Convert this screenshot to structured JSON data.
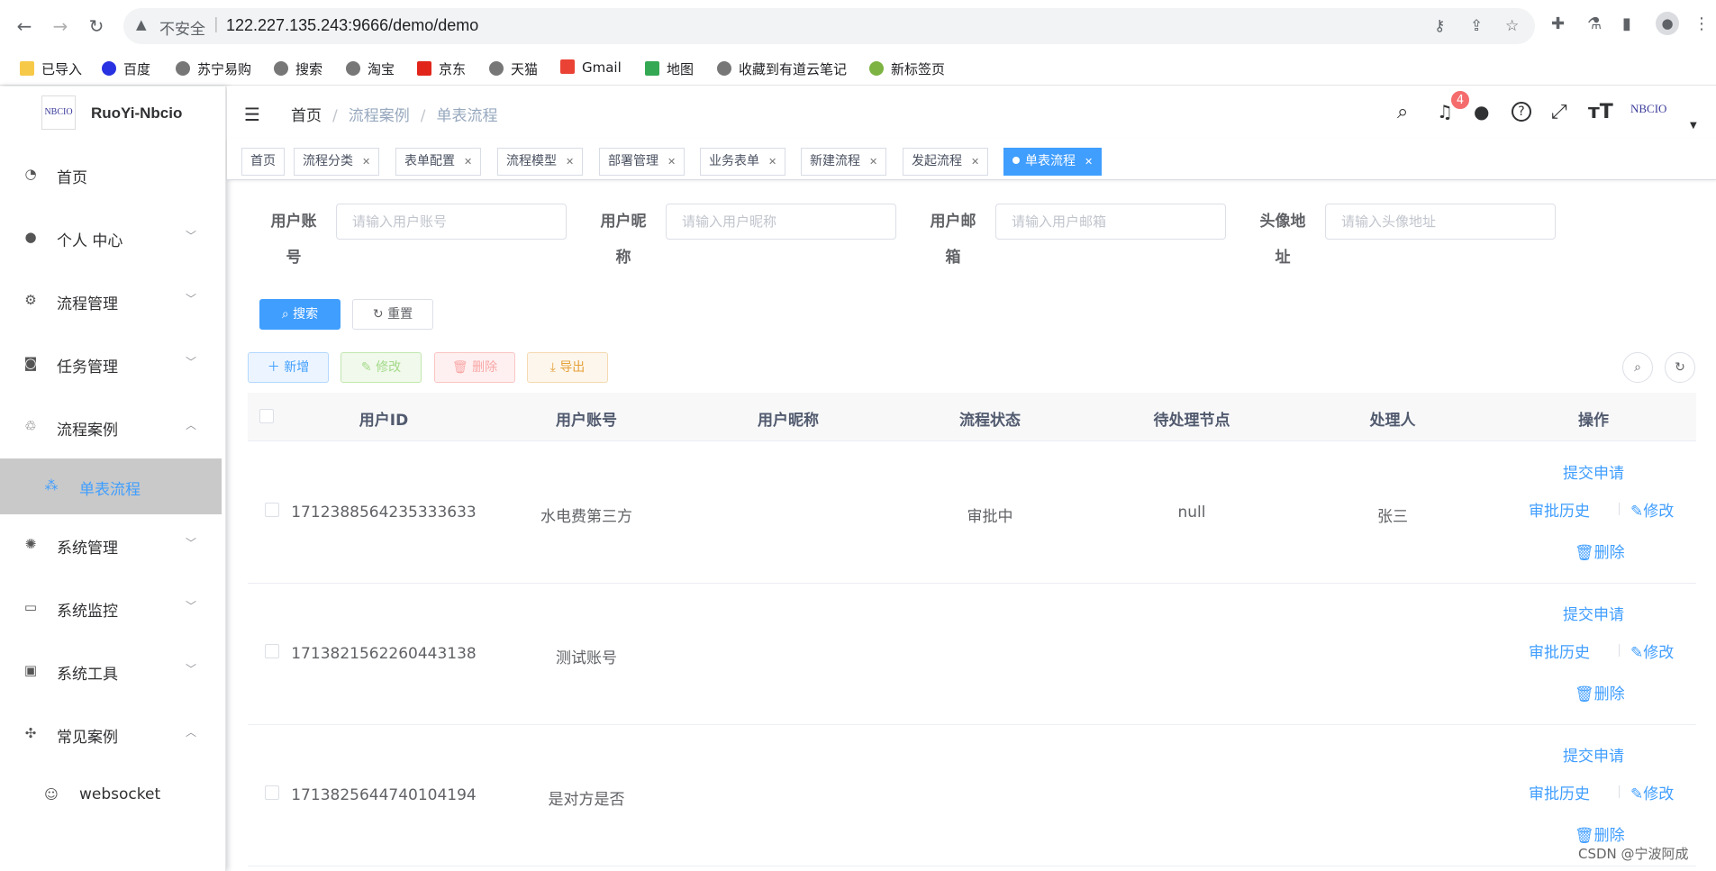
{
  "browser": {
    "insecure_label": "不安全",
    "url": "122.227.135.243:9666/demo/demo",
    "bookmarks": [
      "已导入",
      "百度",
      "苏宁易购",
      "搜索",
      "淘宝",
      "京东",
      "天猫",
      "Gmail",
      "地图",
      "收藏到有道云笔记",
      "新标签页"
    ]
  },
  "sidebar": {
    "logo_text": "NBCIO",
    "title": "RuoYi-Nbcio",
    "items": [
      {
        "label": "首页",
        "icon": "dashboard-icon"
      },
      {
        "label": "个人 中心",
        "icon": "user-icon",
        "arrow": "﹀"
      },
      {
        "label": "流程管理",
        "icon": "flow-icon",
        "arrow": "﹀"
      },
      {
        "label": "任务管理",
        "icon": "task-icon",
        "arrow": "﹀"
      },
      {
        "label": "流程案例",
        "icon": "case-icon",
        "arrow": "︿"
      },
      {
        "label": "单表流程",
        "icon": "tree-icon"
      },
      {
        "label": "系统管理",
        "icon": "system-icon",
        "arrow": "﹀"
      },
      {
        "label": "系统监控",
        "icon": "monitor-icon",
        "arrow": "﹀"
      },
      {
        "label": "系统工具",
        "icon": "tool-icon",
        "arrow": "﹀"
      },
      {
        "label": "常见案例",
        "icon": "example-icon",
        "arrow": "︿"
      },
      {
        "label": "websocket",
        "icon": "robot-icon"
      }
    ]
  },
  "header": {
    "breadcrumb": [
      "首页",
      "流程案例",
      "单表流程"
    ],
    "notification_count": "4",
    "avatar_text": "NBCIO"
  },
  "tags": [
    "首页",
    "流程分类",
    "表单配置",
    "流程模型",
    "部署管理",
    "业务表单",
    "新建流程",
    "发起流程",
    "单表流程"
  ],
  "search": {
    "fields": [
      {
        "label": "用户账号",
        "placeholder": "请输入用户账号",
        "value": ""
      },
      {
        "label": "用户昵称",
        "placeholder": "请输入用户昵称",
        "value": ""
      },
      {
        "label": "用户邮箱",
        "placeholder": "请输入用户邮箱",
        "value": ""
      },
      {
        "label": "头像地址",
        "placeholder": "请输入头像地址",
        "value": ""
      }
    ],
    "search_button": "搜索",
    "reset_button": "重置"
  },
  "toolbar": {
    "add": "新增",
    "edit": "修改",
    "delete": "删除",
    "export": "导出"
  },
  "table": {
    "columns": [
      "用户ID",
      "用户账号",
      "用户昵称",
      "流程状态",
      "待处理节点",
      "处理人",
      "操作"
    ],
    "rows": [
      {
        "id": "1712388564235333633",
        "account": "水电费第三方",
        "nickname": "",
        "status": "审批中",
        "node": "null",
        "handler": "张三"
      },
      {
        "id": "1713821562260443138",
        "account": "测试账号",
        "nickname": "",
        "status": "",
        "node": "",
        "handler": ""
      },
      {
        "id": "1713825644740104194",
        "account": "是对方是否",
        "nickname": "",
        "status": "",
        "node": "",
        "handler": ""
      }
    ],
    "actions": {
      "submit": "提交申请",
      "history": "审批历史",
      "edit": "修改",
      "delete": "删除"
    }
  },
  "watermark": "CSDN @宁波阿成",
  "colors": {
    "primary": "#409eff",
    "danger": "#f56c6c",
    "active_menu_bg": "#c9c9c9"
  }
}
